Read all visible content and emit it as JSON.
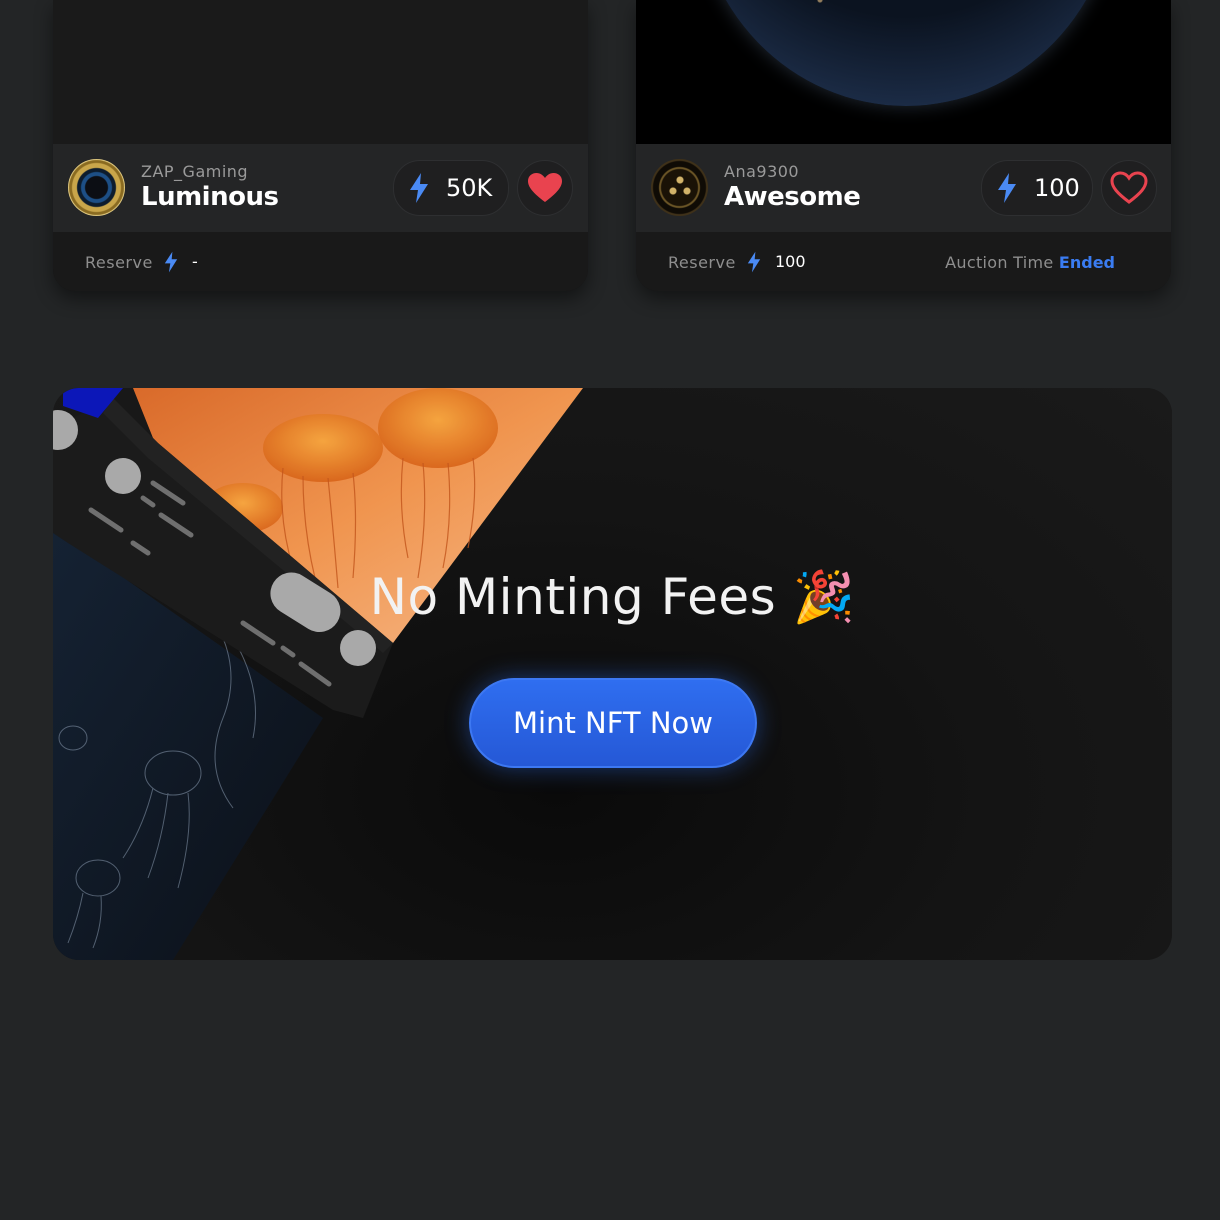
{
  "cards": [
    {
      "creator": "ZAP_Gaming",
      "title": "Luminous",
      "price": "50K",
      "liked": true,
      "reserve_label": "Reserve",
      "reserve_value": "-"
    },
    {
      "creator": "Ana9300",
      "title": "Awesome",
      "price": "100",
      "liked": false,
      "reserve_label": "Reserve",
      "reserve_value": "100",
      "auction_label": "Auction Time",
      "auction_status": "Ended"
    }
  ],
  "banner": {
    "title": "No Minting Fees 🎉",
    "button_label": "Mint NFT Now"
  },
  "colors": {
    "accent": "#3a7cf2",
    "bolt": "#4a8af4",
    "heart": "#e9434f",
    "button": "#2f6ef0",
    "background": "#232526"
  },
  "icons": {
    "price": "lightning-bolt-icon",
    "like": "heart-icon",
    "celebration": "party-popper-emoji"
  }
}
